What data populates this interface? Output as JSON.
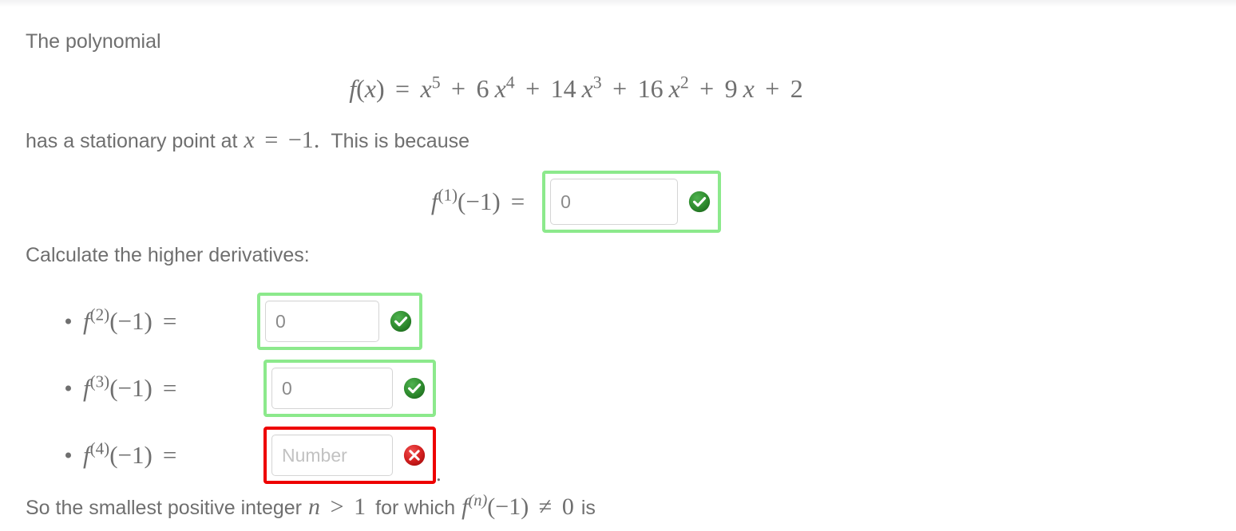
{
  "document": {
    "intro_text": "The polynomial",
    "stationary_text_prefix": "has a stationary point at",
    "stationary_text_suffix": "This is because",
    "calculate_heading": "Calculate the higher derivatives:",
    "closing_prefix": "So the smallest positive integer",
    "closing_middle": "for which",
    "closing_suffix": "is"
  },
  "equation": {
    "function_name": "f",
    "variable": "x",
    "lhs": "f(x)",
    "equals": "=",
    "plain_text": "f(x) = x^5 + 6x^4 + 14x^3 + 16x^2 + 9x + 2",
    "terms": [
      {
        "coefficient": "",
        "variable": "x",
        "exponent": "5"
      },
      {
        "coefficient": "6",
        "variable": "x",
        "exponent": "4"
      },
      {
        "coefficient": "14",
        "variable": "x",
        "exponent": "3"
      },
      {
        "coefficient": "16",
        "variable": "x",
        "exponent": "2"
      },
      {
        "coefficient": "9",
        "variable": "x",
        "exponent": ""
      },
      {
        "coefficient": "2",
        "variable": "",
        "exponent": ""
      }
    ]
  },
  "stationary_point": {
    "variable": "x",
    "equals": "=",
    "value": "−1",
    "period": "."
  },
  "first_derivative_row": {
    "label_f": "f",
    "label_order": "(1)",
    "label_arg": "(−1)",
    "label_equals": "=",
    "field": {
      "value": "0",
      "placeholder": "Number",
      "status": "correct",
      "status_icon": "check-circle-icon"
    }
  },
  "derivative_items": [
    {
      "label_f": "f",
      "label_order": "(2)",
      "label_arg": "(−1)",
      "label_equals": "=",
      "field": {
        "value": "0",
        "placeholder": "Number",
        "status": "correct",
        "status_icon": "check-circle-icon"
      },
      "trailing": ""
    },
    {
      "label_f": "f",
      "label_order": "(3)",
      "label_arg": "(−1)",
      "label_equals": "=",
      "field": {
        "value": "0",
        "placeholder": "Number",
        "status": "correct",
        "status_icon": "check-circle-icon"
      },
      "trailing": ""
    },
    {
      "label_f": "f",
      "label_order": "(4)",
      "label_arg": "(−1)",
      "label_equals": "=",
      "field": {
        "value": "",
        "placeholder": "Number",
        "status": "incorrect",
        "status_icon": "error-circle-icon"
      },
      "trailing": "."
    }
  ],
  "closing": {
    "n_symbol": "n",
    "gt": ">",
    "one": "1",
    "f_symbol": "f",
    "n_superscript": "(n)",
    "arg": "(−1)",
    "neq": "≠",
    "zero": "0"
  },
  "colors": {
    "text": "#6f6f6f",
    "correct_border": "#8ce98c",
    "incorrect_border": "#ee0000",
    "check_green": "#2e8b2e",
    "error_red": "#d42020",
    "input_border": "#d5d5d5",
    "placeholder": "#c2c2c2",
    "page_background": "#ffffff"
  }
}
